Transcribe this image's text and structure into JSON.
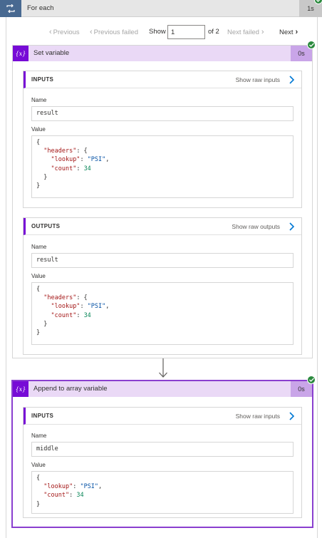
{
  "foreach": {
    "title": "For each",
    "duration": "1s"
  },
  "pager": {
    "previous": "Previous",
    "previous_failed": "Previous failed",
    "show_label": "Show",
    "current": "1",
    "of_label": "of 2",
    "next_failed": "Next failed",
    "next": "Next"
  },
  "set_variable": {
    "icon_text": "{x}",
    "title": "Set variable",
    "duration": "0s",
    "inputs": {
      "title": "INPUTS",
      "raw_link": "Show raw inputs",
      "name_label": "Name",
      "name_value": "result",
      "value_label": "Value",
      "value_lines": [
        [
          {
            "t": "{",
            "c": "p"
          }
        ],
        [
          {
            "t": "  ",
            "c": "p"
          },
          {
            "t": "\"headers\"",
            "c": "k"
          },
          {
            "t": ": {",
            "c": "p"
          }
        ],
        [
          {
            "t": "    ",
            "c": "p"
          },
          {
            "t": "\"lookup\"",
            "c": "k"
          },
          {
            "t": ": ",
            "c": "p"
          },
          {
            "t": "\"PSI\"",
            "c": "s"
          },
          {
            "t": ",",
            "c": "p"
          }
        ],
        [
          {
            "t": "    ",
            "c": "p"
          },
          {
            "t": "\"count\"",
            "c": "k"
          },
          {
            "t": ": ",
            "c": "p"
          },
          {
            "t": "34",
            "c": "n"
          }
        ],
        [
          {
            "t": "  }",
            "c": "p"
          }
        ],
        [
          {
            "t": "}",
            "c": "p"
          }
        ]
      ]
    },
    "outputs": {
      "title": "OUTPUTS",
      "raw_link": "Show raw outputs",
      "name_label": "Name",
      "name_value": "result",
      "value_label": "Value",
      "value_lines": [
        [
          {
            "t": "{",
            "c": "p"
          }
        ],
        [
          {
            "t": "  ",
            "c": "p"
          },
          {
            "t": "\"headers\"",
            "c": "k"
          },
          {
            "t": ": {",
            "c": "p"
          }
        ],
        [
          {
            "t": "    ",
            "c": "p"
          },
          {
            "t": "\"lookup\"",
            "c": "k"
          },
          {
            "t": ": ",
            "c": "p"
          },
          {
            "t": "\"PSI\"",
            "c": "s"
          },
          {
            "t": ",",
            "c": "p"
          }
        ],
        [
          {
            "t": "    ",
            "c": "p"
          },
          {
            "t": "\"count\"",
            "c": "k"
          },
          {
            "t": ": ",
            "c": "p"
          },
          {
            "t": "34",
            "c": "n"
          }
        ],
        [
          {
            "t": "  }",
            "c": "p"
          }
        ],
        [
          {
            "t": "}",
            "c": "p"
          }
        ]
      ]
    }
  },
  "append_array": {
    "icon_text": "{x}",
    "title": "Append to array variable",
    "duration": "0s",
    "inputs": {
      "title": "INPUTS",
      "raw_link": "Show raw inputs",
      "name_label": "Name",
      "name_value": "middle",
      "value_label": "Value",
      "value_lines": [
        [
          {
            "t": "{",
            "c": "p"
          }
        ],
        [
          {
            "t": "  ",
            "c": "p"
          },
          {
            "t": "\"lookup\"",
            "c": "k"
          },
          {
            "t": ": ",
            "c": "p"
          },
          {
            "t": "\"PSI\"",
            "c": "s"
          },
          {
            "t": ",",
            "c": "p"
          }
        ],
        [
          {
            "t": "  ",
            "c": "p"
          },
          {
            "t": "\"count\"",
            "c": "k"
          },
          {
            "t": ": ",
            "c": "p"
          },
          {
            "t": "34",
            "c": "n"
          }
        ],
        [
          {
            "t": "}",
            "c": "p"
          }
        ]
      ]
    }
  },
  "colors": {
    "accent": "#770bd6",
    "success": "#2b8a3e",
    "loop": "#486991"
  },
  "icons": [
    "loop-icon",
    "success-check-icon",
    "chevron-left-icon",
    "chevron-right-icon",
    "variable-icon",
    "down-arrow-icon"
  ]
}
